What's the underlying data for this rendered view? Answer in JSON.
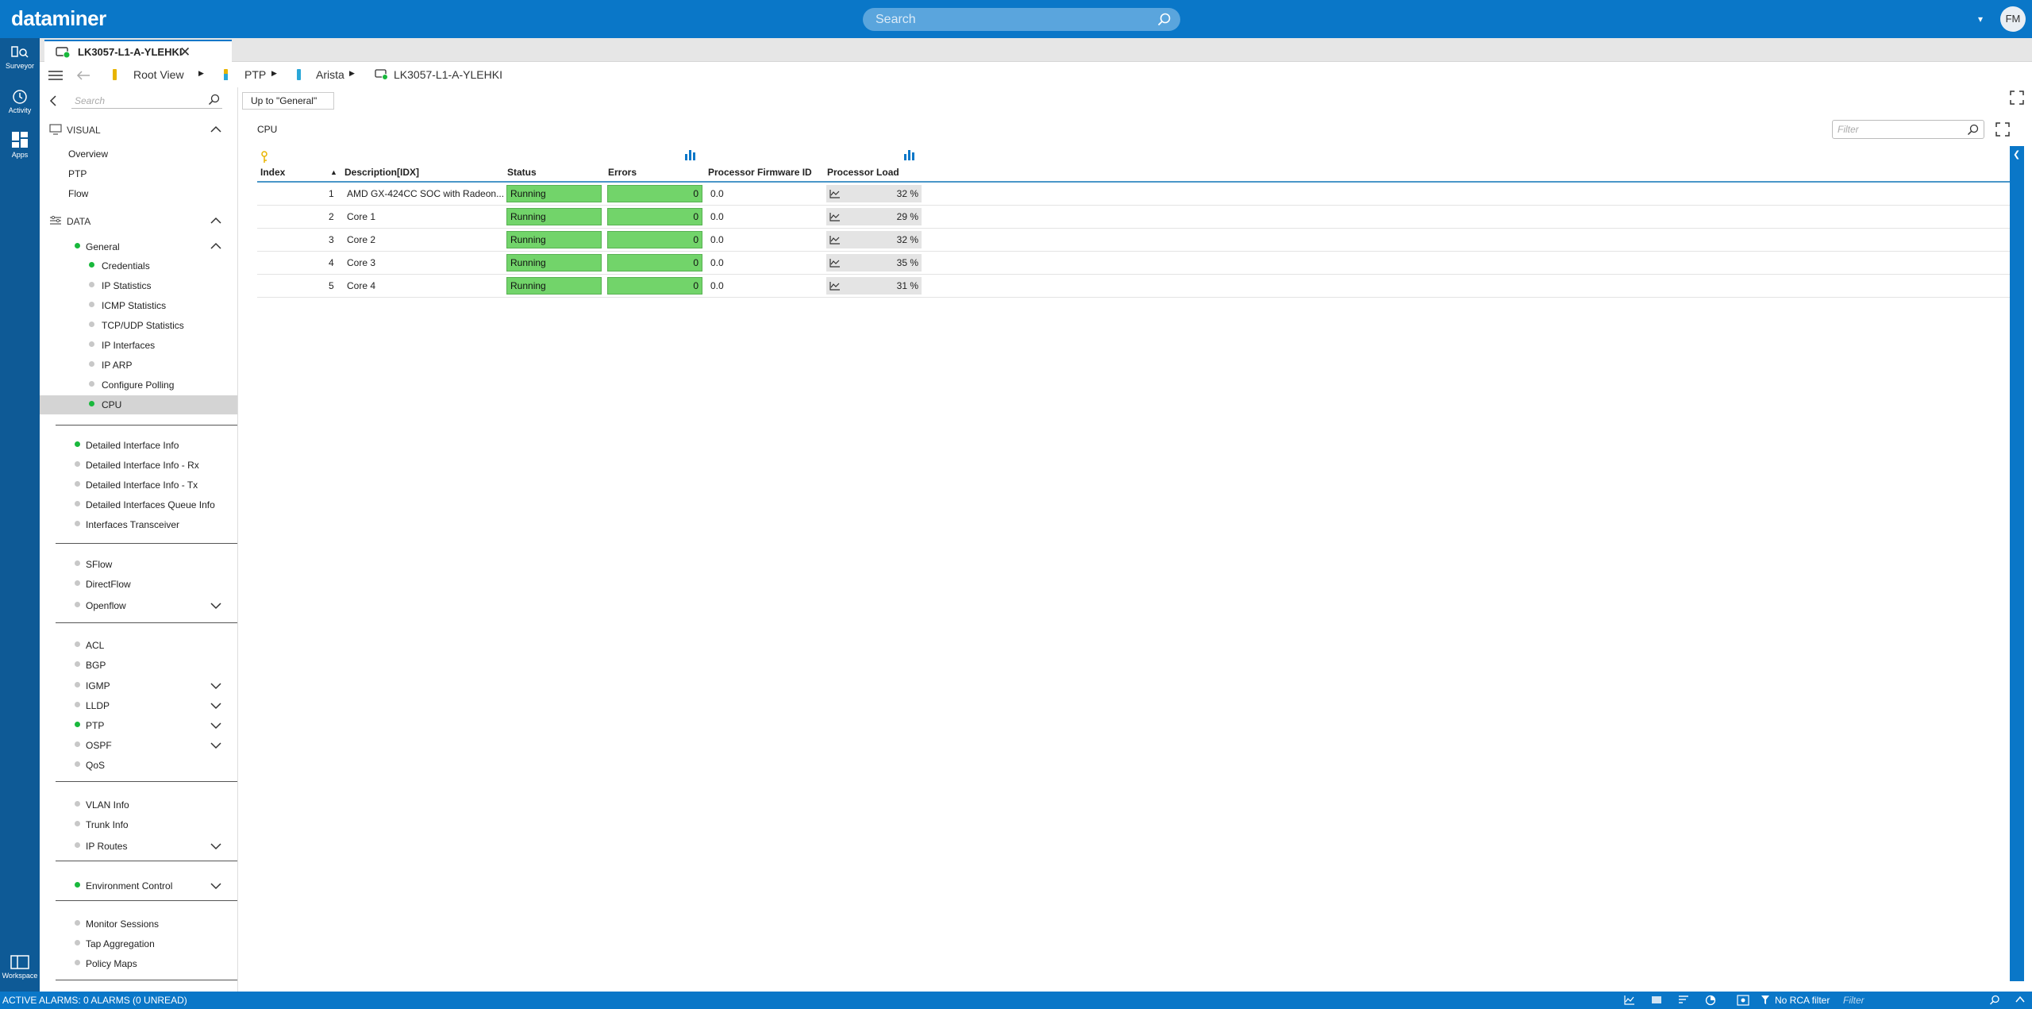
{
  "app": {
    "logo": "dataminer",
    "search_placeholder": "Search",
    "user_initials": "FM"
  },
  "rail": {
    "items": [
      {
        "label": "Surveyor",
        "icon": "surveyor-icon"
      },
      {
        "label": "Activity",
        "icon": "activity-icon"
      },
      {
        "label": "Apps",
        "icon": "apps-icon"
      },
      {
        "label": "Workspace",
        "icon": "workspace-icon"
      }
    ]
  },
  "tab": {
    "label": "LK3057-L1-A-YLEHKI",
    "close": "✕"
  },
  "breadcrumb": {
    "items": [
      "Root View",
      "PTP",
      "Arista",
      "LK3057-L1-A-YLEHKI"
    ]
  },
  "sidebar": {
    "search_placeholder": "Search",
    "visual_label": "VISUAL",
    "visual_items": [
      "Overview",
      "PTP",
      "Flow"
    ],
    "data_label": "DATA",
    "general_label": "General",
    "general_items": [
      {
        "label": "Credentials",
        "status": "green"
      },
      {
        "label": "IP Statistics",
        "status": "grey"
      },
      {
        "label": "ICMP Statistics",
        "status": "grey"
      },
      {
        "label": "TCP/UDP Statistics",
        "status": "grey"
      },
      {
        "label": "IP Interfaces",
        "status": "grey"
      },
      {
        "label": "IP ARP",
        "status": "grey"
      },
      {
        "label": "Configure Polling",
        "status": "grey"
      },
      {
        "label": "CPU",
        "status": "green"
      }
    ],
    "group1": [
      {
        "label": "Detailed Interface Info",
        "status": "green"
      },
      {
        "label": "Detailed Interface Info - Rx",
        "status": "grey"
      },
      {
        "label": "Detailed Interface Info - Tx",
        "status": "grey"
      },
      {
        "label": "Detailed Interfaces Queue Info",
        "status": "grey"
      },
      {
        "label": "Interfaces Transceiver",
        "status": "grey"
      }
    ],
    "group2": [
      {
        "label": "SFlow",
        "status": "grey"
      },
      {
        "label": "DirectFlow",
        "status": "grey"
      },
      {
        "label": "Openflow",
        "status": "grey"
      }
    ],
    "group3": [
      {
        "label": "ACL",
        "status": "grey"
      },
      {
        "label": "BGP",
        "status": "grey"
      },
      {
        "label": "IGMP",
        "status": "grey"
      },
      {
        "label": "LLDP",
        "status": "grey"
      },
      {
        "label": "PTP",
        "status": "green"
      },
      {
        "label": "OSPF",
        "status": "grey"
      },
      {
        "label": "QoS",
        "status": "grey"
      }
    ],
    "group4": [
      {
        "label": "VLAN Info",
        "status": "grey"
      },
      {
        "label": "Trunk Info",
        "status": "grey"
      },
      {
        "label": "IP Routes",
        "status": "grey"
      }
    ],
    "group5": [
      {
        "label": "Environment Control",
        "status": "green"
      }
    ],
    "group6": [
      {
        "label": "Monitor Sessions",
        "status": "grey"
      },
      {
        "label": "Tap Aggregation",
        "status": "grey"
      },
      {
        "label": "Policy Maps",
        "status": "grey"
      }
    ]
  },
  "content": {
    "up_button": "Up to \"General\"",
    "title": "CPU",
    "filter_placeholder": "Filter",
    "columns": [
      "Index",
      "Description[IDX]",
      "Status",
      "Errors",
      "Processor Firmware ID",
      "Processor Load"
    ],
    "rows": [
      {
        "index": "1",
        "description": "AMD GX-424CC SOC with Radeon...",
        "status": "Running",
        "errors": "0",
        "firmware": "0.0",
        "load": "32 %"
      },
      {
        "index": "2",
        "description": "Core 1",
        "status": "Running",
        "errors": "0",
        "firmware": "0.0",
        "load": "29 %"
      },
      {
        "index": "3",
        "description": "Core 2",
        "status": "Running",
        "errors": "0",
        "firmware": "0.0",
        "load": "32 %"
      },
      {
        "index": "4",
        "description": "Core 3",
        "status": "Running",
        "errors": "0",
        "firmware": "0.0",
        "load": "35 %"
      },
      {
        "index": "5",
        "description": "Core 4",
        "status": "Running",
        "errors": "0",
        "firmware": "0.0",
        "load": "31 %"
      }
    ]
  },
  "statusbar": {
    "alarms": "ACTIVE ALARMS: 0 ALARMS (0 UNREAD)",
    "rca": "No RCA filter",
    "filter_placeholder": "Filter"
  },
  "colors": {
    "brand": "#0a77c8",
    "rail": "#0e5a96",
    "ok_green": "#72d46a",
    "status_dot_green": "#19b83c"
  }
}
